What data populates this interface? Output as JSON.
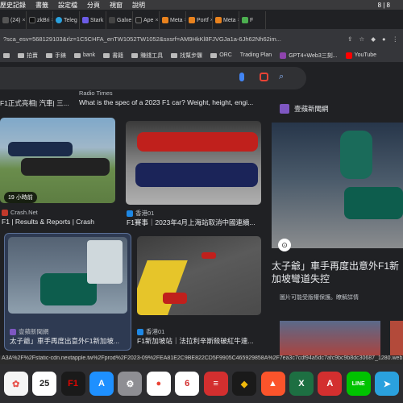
{
  "menubar": {
    "items": [
      "歷史記錄",
      "書籤",
      "設定檔",
      "分頁",
      "視窗",
      "說明"
    ],
    "right": "8 | 8"
  },
  "tabs": [
    {
      "label": "(24)",
      "color": "#555"
    },
    {
      "label": "zkBri",
      "color": "#111"
    },
    {
      "label": "Teleg",
      "color": "#2aa1de"
    },
    {
      "label": "Stark",
      "color": "#6c5ce7"
    },
    {
      "label": "Galxe",
      "color": "#444"
    },
    {
      "label": "Ape",
      "color": "#222"
    },
    {
      "label": "Meta",
      "color": "#e8821e"
    },
    {
      "label": "Portf",
      "color": "#e8821e"
    },
    {
      "label": "Meta",
      "color": "#e8821e"
    },
    {
      "label": "F",
      "color": "#4caf50"
    }
  ],
  "addressbar": {
    "url": "?sca_esv=568129103&rlz=1C5CHFA_enTW1052TW1052&sxsrf=AM9HkKl8FJVGJa1a-6Jh62Nh62im..."
  },
  "bookmarks": [
    "拍賣",
    "手錶",
    "bank",
    "書籍",
    "賺錢工具",
    "找幫步驟",
    "ORC",
    "Trading Plan",
    "GPT4+Web3三刻...",
    "YouTube"
  ],
  "results": {
    "snippet_left": "F1正式亮相| 汽車| 三...",
    "radio_source": "Radio Times",
    "radio_title": "What is the spec of a 2023 F1 car? Weight, height, engi..."
  },
  "cards": [
    {
      "source": "Crash.Net",
      "caption": "F1 | Results & Reports | Crash",
      "badge": "19 小時前"
    },
    {
      "source": "香港01",
      "caption": "F1賽事｜2023年4月上海站取消中國連續..."
    },
    {
      "source": "壹蘋新聞網",
      "caption": "太子爺」車手再度出意外F1新加坡..."
    },
    {
      "source": "香港01",
      "caption": "F1新加坡站｜法拉利辛斯殺破紅牛連..."
    }
  ],
  "panel": {
    "source": "壹蘋新聞網",
    "title": "太子爺」車手再度出意外F1新加坡彎道失控",
    "copyright": "圖片可能受版權保護。瞭解詳情"
  },
  "statusbar": {
    "url": "A3A%2F%2Fstatic-cdn.nextapple.tw%2Fprod%2F2023-09%2FEA81E2C9BE822CD5F9905C465929858A%2F7ea3c7cdf94a5dc7afc9bc9b8dc30687_1280.web"
  },
  "dock": [
    {
      "name": "photos",
      "label": "✿",
      "color": "#f5f5f5"
    },
    {
      "name": "calendar",
      "label": "25",
      "color": "#ffffff"
    },
    {
      "name": "f1-app",
      "label": "F1",
      "color": "#1a1a1a"
    },
    {
      "name": "app-store",
      "label": "A",
      "color": "#1e90ff"
    },
    {
      "name": "system-settings",
      "label": "⚙",
      "color": "#8e8e93"
    },
    {
      "name": "chrome",
      "label": "●",
      "color": "#ffffff"
    },
    {
      "name": "app-6",
      "label": "6",
      "color": "#ffffff"
    },
    {
      "name": "app-red-square",
      "label": "≡",
      "color": "#d32f2f"
    },
    {
      "name": "binance",
      "label": "◆",
      "color": "#1a1a1a"
    },
    {
      "name": "brave",
      "label": "▲",
      "color": "#fb542b"
    },
    {
      "name": "excel",
      "label": "X",
      "color": "#1d6f42"
    },
    {
      "name": "acrobat",
      "label": "A",
      "color": "#d32f2f"
    },
    {
      "name": "line",
      "label": "LINE",
      "color": "#00c300"
    },
    {
      "name": "telegram",
      "label": "➤",
      "color": "#2aa1de"
    }
  ]
}
